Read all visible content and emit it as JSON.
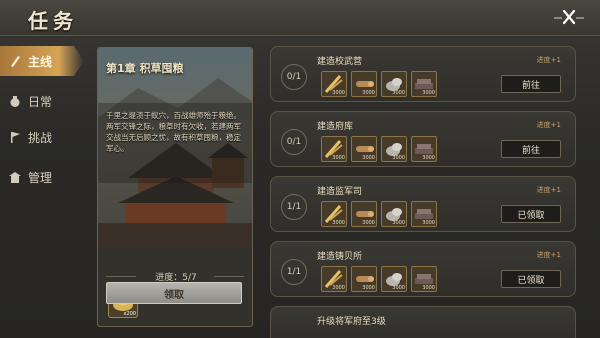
{
  "header": {
    "title": "任务"
  },
  "sidebar": {
    "items": [
      {
        "label": "主线",
        "icon": "brush-icon",
        "active": true
      },
      {
        "label": "日常",
        "icon": "pouch-icon",
        "active": false
      },
      {
        "label": "挑战",
        "icon": "flag-icon",
        "active": false
      },
      {
        "label": "管理",
        "icon": "building-icon",
        "active": false
      }
    ]
  },
  "chapter": {
    "title": "第1章 积草囤粮",
    "description": "千里之堤溃于蚁穴，百战雄师殆于粮绝。两军交锋之际，粮草时有欠收，若建两军交战当无后顾之忧，故有积草囤粮，稳定军心。",
    "progress_label": "进度：5/7",
    "reward_amount": "x200",
    "claim_label": "领取"
  },
  "tasks": [
    {
      "name": "建造校武营",
      "count": "0/1",
      "bonus": "进度+1",
      "button": "前往",
      "resources": [
        {
          "icon": "grain-icon",
          "amount": "3000"
        },
        {
          "icon": "wood-icon",
          "amount": "3000"
        },
        {
          "icon": "stone-icon",
          "amount": "3000"
        },
        {
          "icon": "iron-icon",
          "amount": "3000"
        }
      ]
    },
    {
      "name": "建造府库",
      "count": "0/1",
      "bonus": "进度+1",
      "button": "前往",
      "resources": [
        {
          "icon": "grain-icon",
          "amount": "3000"
        },
        {
          "icon": "wood-icon",
          "amount": "3000"
        },
        {
          "icon": "stone-icon",
          "amount": "3000"
        },
        {
          "icon": "iron-icon",
          "amount": "3000"
        }
      ]
    },
    {
      "name": "建造监军司",
      "count": "1/1",
      "bonus": "进度+1",
      "button": "已领取",
      "resources": [
        {
          "icon": "grain-icon",
          "amount": "3000"
        },
        {
          "icon": "wood-icon",
          "amount": "3000"
        },
        {
          "icon": "stone-icon",
          "amount": "3000"
        },
        {
          "icon": "iron-icon",
          "amount": "3000"
        }
      ]
    },
    {
      "name": "建造铸贝所",
      "count": "1/1",
      "bonus": "进度+1",
      "button": "已领取",
      "resources": [
        {
          "icon": "grain-icon",
          "amount": "3000"
        },
        {
          "icon": "wood-icon",
          "amount": "3000"
        },
        {
          "icon": "stone-icon",
          "amount": "3000"
        },
        {
          "icon": "iron-icon",
          "amount": "3000"
        }
      ]
    },
    {
      "name": "升级将军府至3级",
      "count": "",
      "bonus": "",
      "button": "",
      "resources": []
    }
  ],
  "colors": {
    "accent": "#d7a456",
    "panel": "#302e2a",
    "border": "#5b5446"
  }
}
